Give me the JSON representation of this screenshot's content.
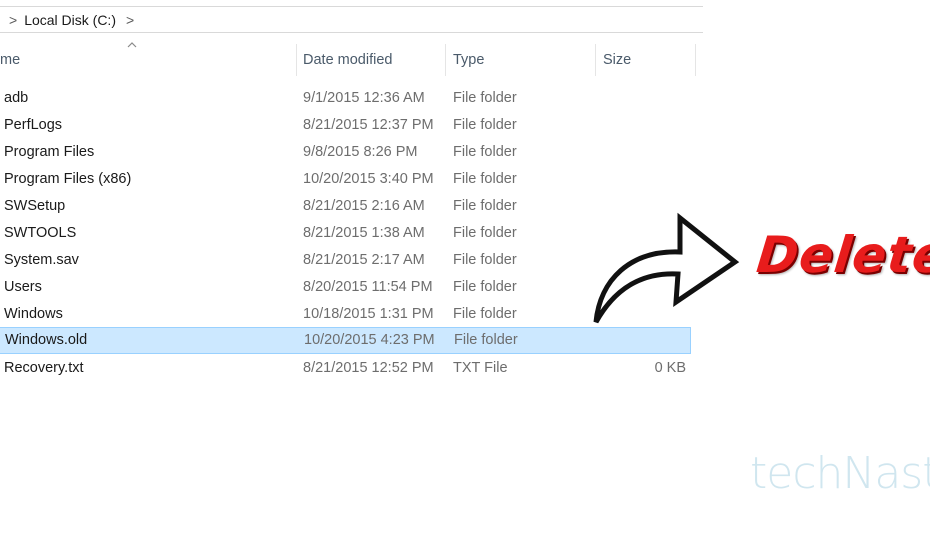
{
  "address": {
    "chevron_left": ">",
    "path": "Local Disk (C:)",
    "chevron_right": ">"
  },
  "columns": {
    "name": "me",
    "date": "Date modified",
    "type": "Type",
    "size": "Size"
  },
  "files": [
    {
      "name": "adb",
      "date": "9/1/2015 12:36 AM",
      "type": "File folder",
      "size": ""
    },
    {
      "name": "PerfLogs",
      "date": "8/21/2015 12:37 PM",
      "type": "File folder",
      "size": ""
    },
    {
      "name": "Program Files",
      "date": "9/8/2015 8:26 PM",
      "type": "File folder",
      "size": ""
    },
    {
      "name": "Program Files (x86)",
      "date": "10/20/2015 3:40 PM",
      "type": "File folder",
      "size": ""
    },
    {
      "name": "SWSetup",
      "date": "8/21/2015 2:16 AM",
      "type": "File folder",
      "size": ""
    },
    {
      "name": "SWTOOLS",
      "date": "8/21/2015 1:38 AM",
      "type": "File folder",
      "size": ""
    },
    {
      "name": "System.sav",
      "date": "8/21/2015 2:17 AM",
      "type": "File folder",
      "size": ""
    },
    {
      "name": "Users",
      "date": "8/20/2015 11:54 PM",
      "type": "File folder",
      "size": ""
    },
    {
      "name": "Windows",
      "date": "10/18/2015 1:31 PM",
      "type": "File folder",
      "size": ""
    },
    {
      "name": "Windows.old",
      "date": "10/20/2015 4:23 PM",
      "type": "File folder",
      "size": "",
      "selected": true
    },
    {
      "name": "Recovery.txt",
      "date": "8/21/2015 12:52 PM",
      "type": "TXT File",
      "size": "0 KB"
    }
  ],
  "annotation": {
    "label": "Delete",
    "color": "#e81c1c",
    "arrow_icon": "curved-arrow-right-icon"
  },
  "watermark": "techNastic",
  "colors": {
    "selection_bg": "#cce8ff",
    "selection_border": "#99d1ff"
  }
}
